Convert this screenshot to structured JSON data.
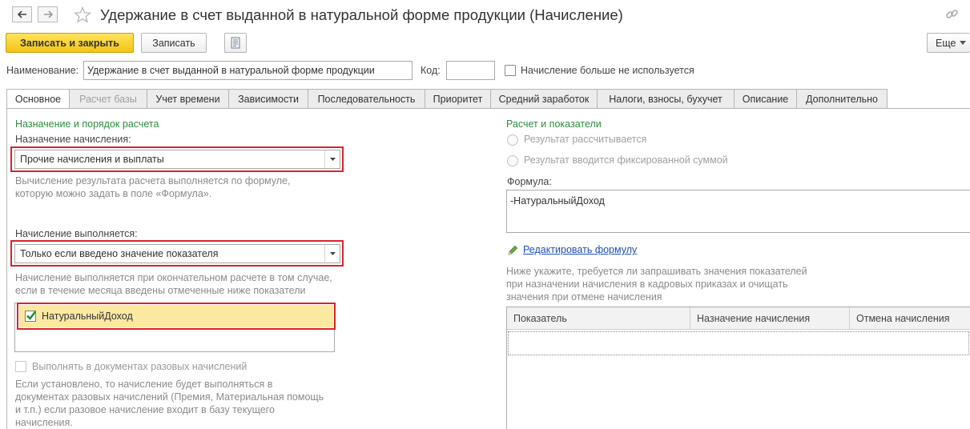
{
  "window": {
    "title": "Удержание в счет выданной в натуральной форме продукции (Начисление)"
  },
  "toolbar": {
    "save_close_label": "Записать и закрыть",
    "save_label": "Записать",
    "more_label": "Еще"
  },
  "header": {
    "name_label": "Наименование:",
    "name_value": "Удержание в счет выданной в натуральной форме продукции",
    "code_label": "Код:",
    "code_value": "",
    "not_used_label": "Начисление больше не используется"
  },
  "tabs": [
    {
      "label": "Основное",
      "state": "active"
    },
    {
      "label": "Расчет базы",
      "state": "disabled"
    },
    {
      "label": "Учет времени",
      "state": "normal"
    },
    {
      "label": "Зависимости",
      "state": "normal"
    },
    {
      "label": "Последовательность",
      "state": "normal"
    },
    {
      "label": "Приоритет",
      "state": "normal"
    },
    {
      "label": "Средний заработок",
      "state": "normal"
    },
    {
      "label": "Налоги, взносы, бухучет",
      "state": "normal"
    },
    {
      "label": "Описание",
      "state": "normal"
    },
    {
      "label": "Дополнительно",
      "state": "normal"
    }
  ],
  "left": {
    "group_title": "Назначение и порядок расчета",
    "purpose_label": "Назначение начисления:",
    "purpose_value": "Прочие начисления и выплаты",
    "purpose_hint_1": "Вычисление результата расчета выполняется по формуле,",
    "purpose_hint_2": "которую можно задать в поле «Формула».",
    "execution_label": "Начисление выполняется:",
    "execution_value": "Только если введено значение показателя",
    "execution_hint_1": "Начисление выполняется при окончательном расчете в том случае,",
    "execution_hint_2": "если в течение месяца введены отмеченные ниже показатели",
    "indicator_item": "НатуральныйДоход",
    "one_time_label": "Выполнять в документах разовых начислений",
    "one_time_hint_1": "Если установлено, то начисление будет выполняться в",
    "one_time_hint_2": "документах разовых начислений (Премия, Материальная помощь",
    "one_time_hint_3": "и т.п.) если разовое начисление входит в базу текущего",
    "one_time_hint_4": "начисления."
  },
  "right": {
    "group_title": "Расчет и показатели",
    "radio_calc": "Результат рассчитывается",
    "radio_fixed": "Результат вводится фиксированной суммой",
    "formula_label": "Формула:",
    "formula_value": "-НатуральныйДоход",
    "edit_formula_link": "Редактировать формулу",
    "grid_hint_1": "Ниже укажите, требуется ли запрашивать значения показателей",
    "grid_hint_2": "при назначении начисления в кадровых приказах и очищать",
    "grid_hint_3": "значения при отмене начисления",
    "grid_columns": [
      "Показатель",
      "Назначение начисления",
      "Отмена начисления"
    ]
  },
  "colors": {
    "accent_yellow": "#f4c414",
    "group_title_green": "#2e8b3e",
    "highlight_red": "#d9232d",
    "selected_row": "#fbe9a2",
    "link_blue": "#1f4fb5"
  },
  "icons": [
    "back-arrow-icon",
    "forward-arrow-icon",
    "star-icon",
    "link-icon",
    "report-icon",
    "dropdown-arrow-icon",
    "checkmark-icon",
    "pencil-icon"
  ]
}
